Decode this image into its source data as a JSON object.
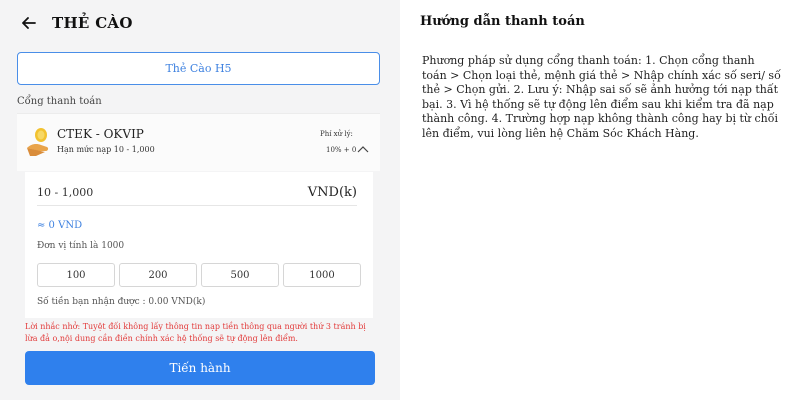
{
  "header": {
    "title": "THẺ CÀO"
  },
  "card_tab": {
    "label": "Thẻ Cào H5"
  },
  "gateway": {
    "section_label": "Cổng thanh toán",
    "name": "CTEK - OKVIP",
    "limit": "Hạn mức nạp 10 - 1,000",
    "fee_label": "Phí xử lý:",
    "fee_value": "10% + 0"
  },
  "form": {
    "amount_value": "10 - 1,000",
    "amount_unit": "VND(k)",
    "converted": "≈ 0 VND",
    "unit_note": "Đơn vị tính là 1000",
    "presets": [
      "100",
      "200",
      "500",
      "1000"
    ],
    "received": "Số tiền bạn nhận được : 0.00 VND(k)"
  },
  "warning": "Lời nhắc nhở: Tuyệt đối không lấy thông tin nạp tiền thông qua người thứ 3 tránh bị lừa đả o,nội dung cần điền chính xác hệ thống sẽ tự động lên điểm.",
  "submit_label": "Tiến hành",
  "guide": {
    "title": "Hướng dẫn thanh toán",
    "text": "Phương pháp sử dụng cổng thanh toán: 1. Chọn cổng thanh toán > Chọn loại thẻ, mệnh giá thẻ > Nhập chính xác số seri/ số thẻ > Chọn gửi. 2. Lưu ý: Nhập sai số sẽ ảnh hưởng tới nạp thất bại. 3. Vì hệ thống sẽ tự động lên điểm sau khi kiểm tra đã nạp thành công. 4. Trường hợp nạp không thành công hay bị từ chối lên điểm, vui lòng liên hệ Chăm Sóc Khách Hàng."
  },
  "colors": {
    "accent": "#2f80ed",
    "warning": "#e23b3b",
    "panel_bg": "#f4f4f5"
  },
  "icons": {
    "back": "arrow-left-icon",
    "gateway_logo": "coin-hand-icon",
    "collapse": "chevron-up-icon"
  }
}
